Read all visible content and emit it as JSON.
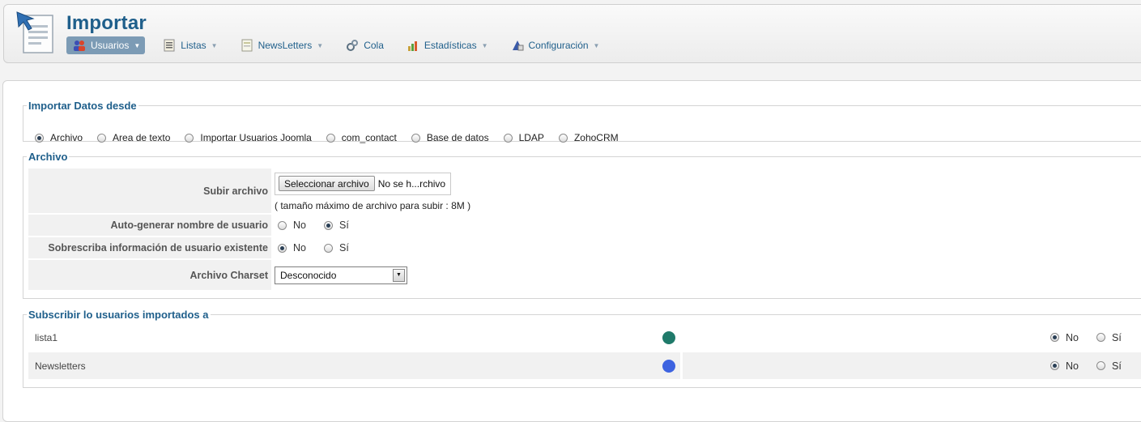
{
  "header": {
    "title": "Importar",
    "nav": [
      {
        "label": "Usuarios",
        "icon": "users-icon",
        "active": true
      },
      {
        "label": "Listas",
        "icon": "list-icon",
        "active": false
      },
      {
        "label": "NewsLetters",
        "icon": "newsletter-icon",
        "active": false
      },
      {
        "label": "Cola",
        "icon": "queue-gears-icon",
        "active": false
      },
      {
        "label": "Estadísticas",
        "icon": "statistics-icon",
        "active": false
      },
      {
        "label": "Configuración",
        "icon": "settings-icon",
        "active": false
      }
    ]
  },
  "import_source": {
    "legend": "Importar Datos desde",
    "options": [
      "Archivo",
      "Area de texto",
      "Importar Usuarios Joomla",
      "com_contact",
      "Base de datos",
      "LDAP",
      "ZohoCRM"
    ],
    "selected": "Archivo"
  },
  "archivo": {
    "legend": "Archivo",
    "upload_label": "Subir archivo",
    "file_button": "Seleccionar archivo",
    "file_status": "No se h...rchivo",
    "file_hint": "( tamaño máximo de archivo para subir : 8M )",
    "autogen_label": "Auto-generar nombre de usuario",
    "autogen_value": "Sí",
    "overwrite_label": "Sobrescriba información de usuario existente",
    "overwrite_value": "No",
    "charset_label": "Archivo Charset",
    "charset_value": "Desconocido",
    "no_label": "No",
    "yes_label": "Sí"
  },
  "subscribe": {
    "legend": "Subscribir lo usuarios importados a",
    "lists": [
      {
        "name": "lista1",
        "color": "#1f7a6a",
        "value": "No"
      },
      {
        "name": "Newsletters",
        "color": "#3d63e0",
        "value": "No"
      }
    ],
    "no_label": "No",
    "yes_label": "Sí"
  },
  "colors": {
    "accent": "#1f5f8b",
    "nav_active_bg": "#7c9bb5"
  }
}
